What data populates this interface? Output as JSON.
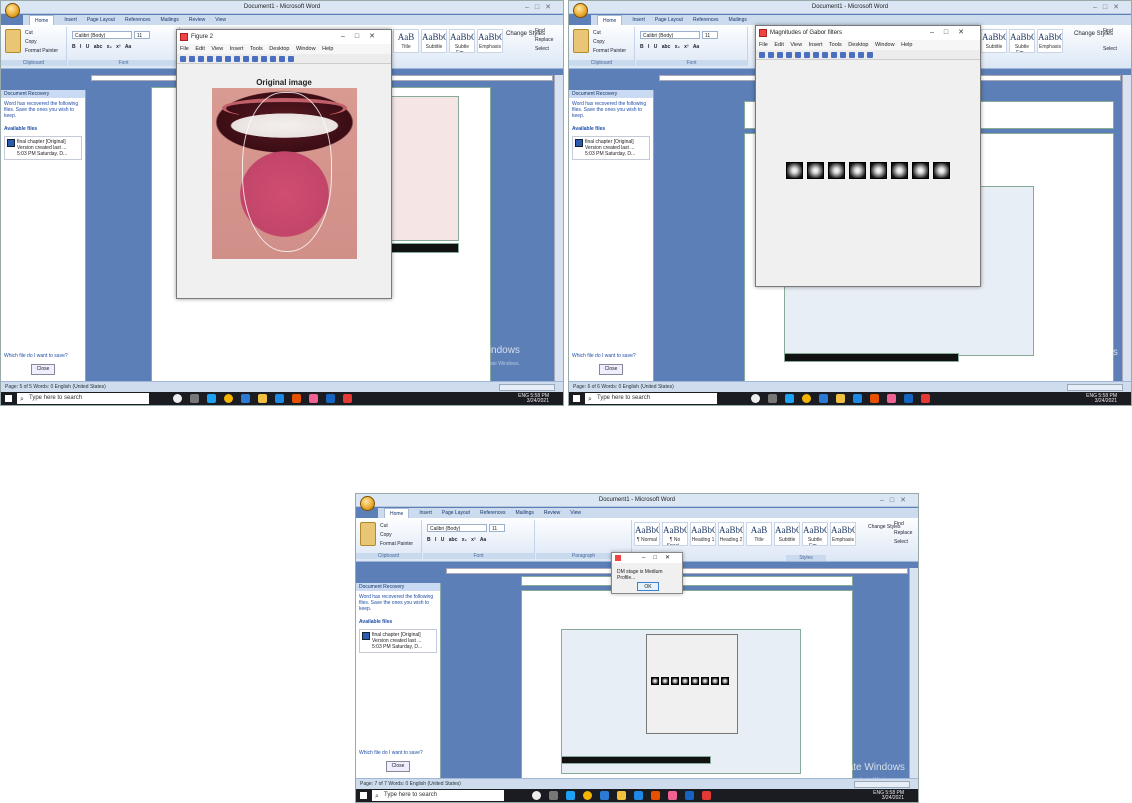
{
  "word": {
    "title": "Document1 - Microsoft Word",
    "tabs": [
      "Home",
      "Insert",
      "Page Layout",
      "References",
      "Mailings",
      "Review",
      "View"
    ],
    "clipboard": {
      "cut": "Cut",
      "copy": "Copy",
      "format_painter": "Format Painter",
      "paste": "Paste",
      "group": "Clipboard"
    },
    "font": {
      "name": "Calibri (Body)",
      "size": "11",
      "group": "Font"
    },
    "paragraph_group": "Paragraph",
    "styles": [
      {
        "sample": "AaBbCcDc",
        "label": "¶ Normal"
      },
      {
        "sample": "AaBbCcDc",
        "label": "¶ No Spaci..."
      },
      {
        "sample": "AaBbCc",
        "label": "Heading 1"
      },
      {
        "sample": "AaBbCc",
        "label": "Heading 2"
      },
      {
        "sample": "AaB",
        "label": "Title"
      },
      {
        "sample": "AaBbCc.",
        "label": "Subtitle"
      },
      {
        "sample": "AaBbCcDc",
        "label": "Subtle Em..."
      },
      {
        "sample": "AaBbCcDc",
        "label": "Emphasis"
      }
    ],
    "styles_group": "Styles",
    "change_styles": "Change Styles",
    "editing": {
      "find": "Find",
      "replace": "Replace",
      "select": "Select",
      "group": "Editing"
    },
    "recovery": {
      "header": "Document Recovery",
      "text": "Word has recovered the following files. Save the ones you wish to keep.",
      "available": "Available files",
      "file_name": "final chapter [Original]",
      "file_sub1": "Version created last ...",
      "file_sub2": "5:03 PM Saturday, D...",
      "which": "Which file do I want to save?",
      "close": "Close"
    },
    "activate": {
      "title": "Activate Windows",
      "sub": "Go to Settings to activate Windows."
    },
    "status": {
      "s1": "Page: 5 of 5   Words: 0   English (United States)",
      "s2": "Page: 6 of 6   Words: 0   English (United States)",
      "s3": "Page: 7 of 7   Words: 0   English (United States)"
    },
    "zoom": "100%"
  },
  "taskbar": {
    "search": "Type here to search",
    "time": "5:58 PM",
    "date": "3/24/2021",
    "lang": "ENG"
  },
  "figure1": {
    "window_title": "Figure 2",
    "menu": "File  Edit  View  Insert  Tools  Desktop  Window  Help",
    "plot_title": "Original image"
  },
  "figure2": {
    "window_title": "Magnitudes of Gabor filters",
    "menu": "File  Edit  View  Insert  Tools  Desktop  Window  Help",
    "filter_count": 8
  },
  "dialog": {
    "message": "DM stage is Medium Profile...",
    "ok": "OK"
  }
}
